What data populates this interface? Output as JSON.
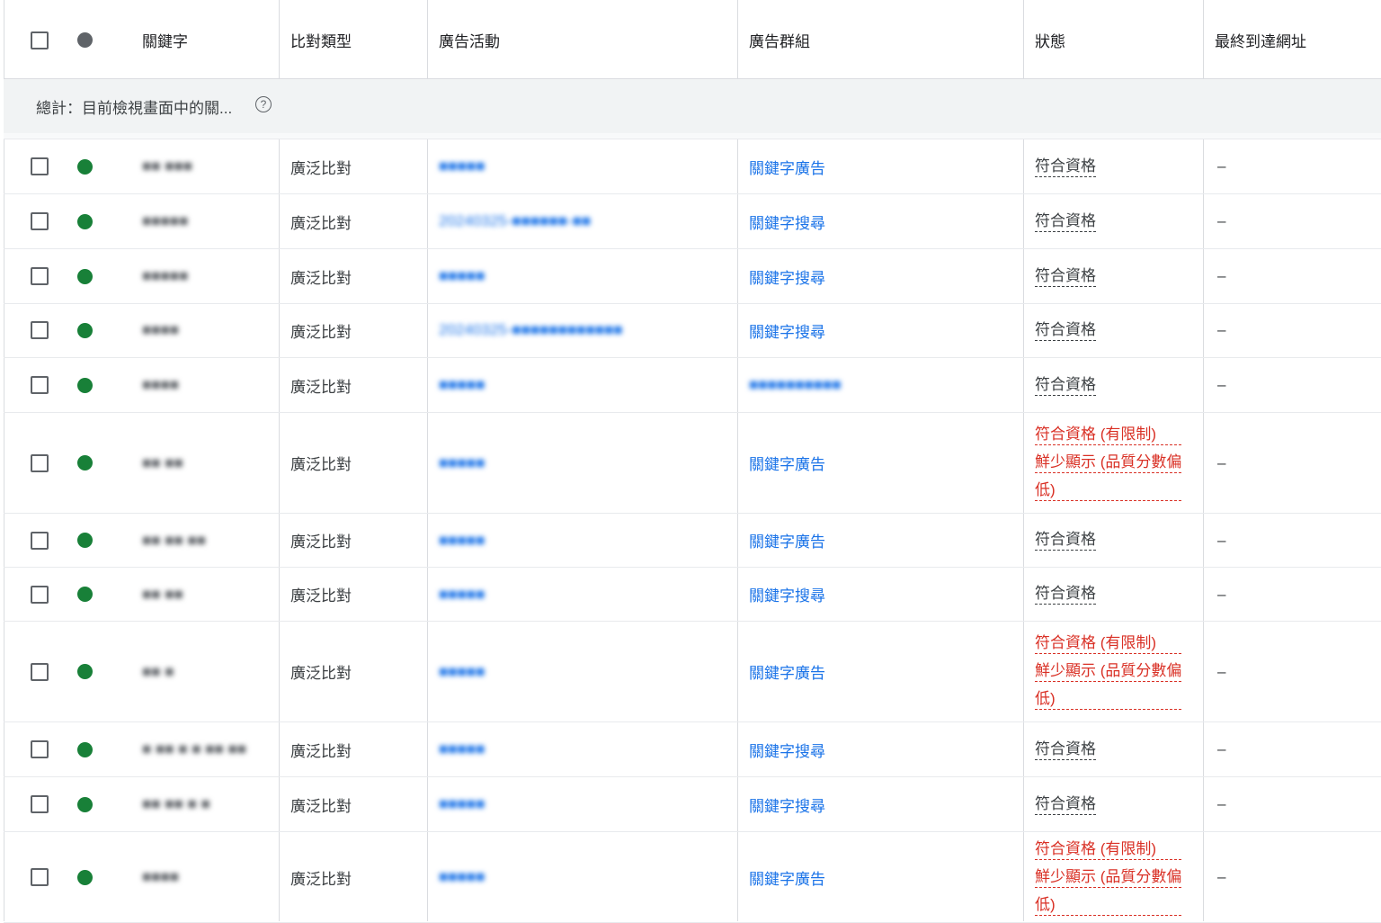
{
  "header": {
    "keyword": "關鍵字",
    "match_type": "比對類型",
    "campaign": "廣告活動",
    "ad_group": "廣告群組",
    "status": "狀態",
    "final_url": "最終到達網址"
  },
  "summary": {
    "label": "總計：目前檢視畫面中的關...",
    "help_icon": "?"
  },
  "rows": [
    {
      "keyword": "■■ ■■■",
      "match_type": "廣泛比對",
      "campaign": "■■■■■",
      "ad_group": "關鍵字廣告",
      "ad_group_blurred": false,
      "status": [
        "符合資格"
      ],
      "status_red": false,
      "final_url": "–"
    },
    {
      "keyword": "■■■■■",
      "match_type": "廣泛比對",
      "campaign": "20240325-■■■■■■-■■",
      "ad_group": "關鍵字搜尋",
      "ad_group_blurred": false,
      "status": [
        "符合資格"
      ],
      "status_red": false,
      "final_url": "–"
    },
    {
      "keyword": "■■■■■",
      "match_type": "廣泛比對",
      "campaign": "■■■■■",
      "ad_group": "關鍵字搜尋",
      "ad_group_blurred": false,
      "status": [
        "符合資格"
      ],
      "status_red": false,
      "final_url": "–"
    },
    {
      "keyword": "■■■■",
      "match_type": "廣泛比對",
      "campaign": "20240325-■■■■■■■■■■■■",
      "ad_group": "關鍵字搜尋",
      "ad_group_blurred": false,
      "status": [
        "符合資格"
      ],
      "status_red": false,
      "final_url": "–"
    },
    {
      "keyword": "■■■■",
      "match_type": "廣泛比對",
      "campaign": "■■■■■",
      "ad_group": "■■■■■■■■■■",
      "ad_group_blurred": true,
      "status": [
        "符合資格"
      ],
      "status_red": false,
      "final_url": "–"
    },
    {
      "keyword": "■■ ■■",
      "match_type": "廣泛比對",
      "campaign": "■■■■■",
      "ad_group": "關鍵字廣告",
      "ad_group_blurred": false,
      "status": [
        "符合資格 (有限制)",
        "鮮少顯示 (品質分數偏",
        "低)"
      ],
      "status_red": true,
      "final_url": "–"
    },
    {
      "keyword": "■■ ■■ ■■",
      "match_type": "廣泛比對",
      "campaign": "■■■■■",
      "ad_group": "關鍵字廣告",
      "ad_group_blurred": false,
      "status": [
        "符合資格"
      ],
      "status_red": false,
      "final_url": "–"
    },
    {
      "keyword": "■■ ■■",
      "match_type": "廣泛比對",
      "campaign": "■■■■■",
      "ad_group": "關鍵字搜尋",
      "ad_group_blurred": false,
      "status": [
        "符合資格"
      ],
      "status_red": false,
      "final_url": "–"
    },
    {
      "keyword": "■■ ■",
      "match_type": "廣泛比對",
      "campaign": "■■■■■",
      "ad_group": "關鍵字廣告",
      "ad_group_blurred": false,
      "status": [
        "符合資格 (有限制)",
        "鮮少顯示 (品質分數偏",
        "低)"
      ],
      "status_red": true,
      "final_url": "–"
    },
    {
      "keyword": "■ ■■ ■ ■ ■■ ■■",
      "match_type": "廣泛比對",
      "campaign": "■■■■■",
      "ad_group": "關鍵字搜尋",
      "ad_group_blurred": false,
      "status": [
        "符合資格"
      ],
      "status_red": false,
      "final_url": "–"
    },
    {
      "keyword": "■■ ■■ ■ ■",
      "match_type": "廣泛比對",
      "campaign": "■■■■■",
      "ad_group": "關鍵字搜尋",
      "ad_group_blurred": false,
      "status": [
        "符合資格"
      ],
      "status_red": false,
      "final_url": "–"
    },
    {
      "keyword": "■■■■",
      "match_type": "廣泛比對",
      "campaign": "■■■■■",
      "ad_group": "關鍵字廣告",
      "ad_group_blurred": false,
      "status": [
        "符合資格 (有限制)",
        "鮮少顯示 (品質分數偏",
        "低)"
      ],
      "status_red": true,
      "final_url": "–"
    }
  ],
  "colors": {
    "enabled_dot": "#188038",
    "link": "#1a73e8",
    "limited_status": "#d93025"
  }
}
